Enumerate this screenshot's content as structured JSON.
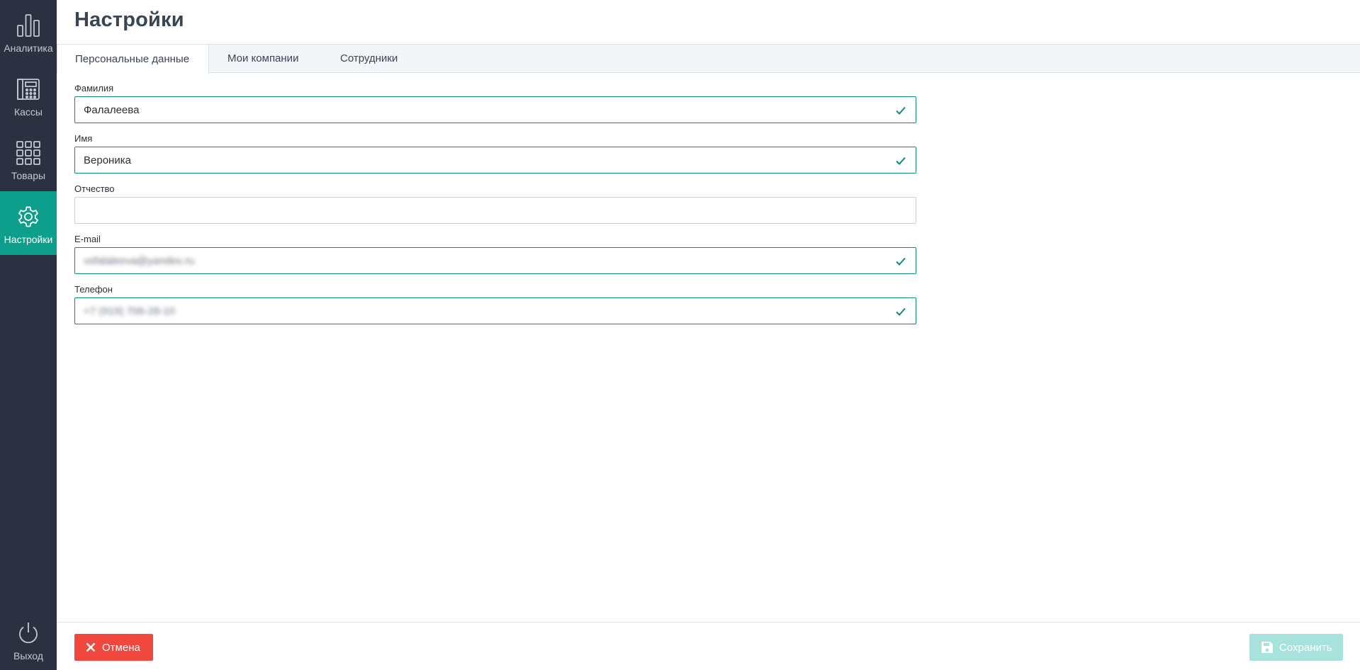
{
  "sidebar": {
    "items": [
      {
        "label": "Аналитика",
        "icon": "bar-chart-icon"
      },
      {
        "label": "Кассы",
        "icon": "cash-register-icon"
      },
      {
        "label": "Товары",
        "icon": "grid-icon"
      },
      {
        "label": "Настройки",
        "icon": "gear-icon",
        "active": true
      }
    ],
    "exit_label": "Выход",
    "exit_icon": "power-icon"
  },
  "header": {
    "title": "Настройки"
  },
  "tabs": [
    {
      "label": "Персональные данные",
      "active": true
    },
    {
      "label": "Мои компании"
    },
    {
      "label": "Сотрудники"
    }
  ],
  "form": {
    "fields": [
      {
        "label": "Фамилия",
        "value": "Фалалеева",
        "valid": true
      },
      {
        "label": "Имя",
        "value": "Вероника",
        "valid": true
      },
      {
        "label": "Отчество",
        "value": "",
        "valid": false
      },
      {
        "label": "E-mail",
        "value": "vsfalaleeva@yandex.ru",
        "valid": true,
        "blurred": true
      },
      {
        "label": "Телефон",
        "value": "+7 (919) 706-28-10",
        "valid": true,
        "blurred": true
      }
    ]
  },
  "footer": {
    "cancel_label": "Отмена",
    "save_label": "Сохранить"
  },
  "colors": {
    "sidebar_bg": "#2b3140",
    "accent": "#0d9e8c",
    "cancel": "#f0473e",
    "save_disabled": "#a8e2dc"
  }
}
